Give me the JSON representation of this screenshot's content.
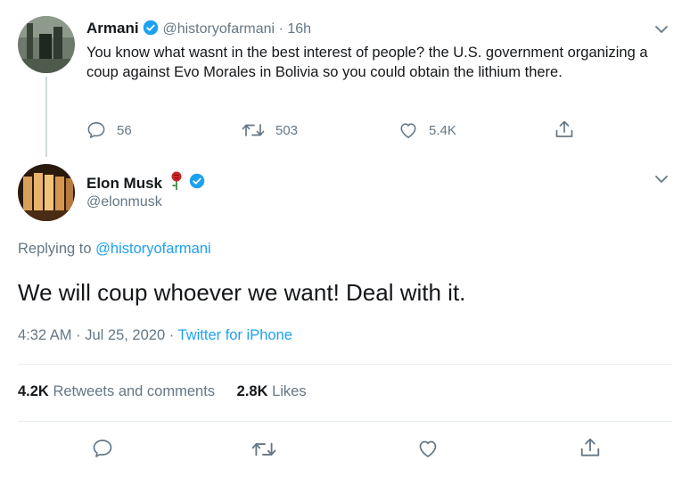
{
  "parent_tweet": {
    "author_name": "Armani",
    "handle": "@historyofarmani",
    "separator": "·",
    "time": "16h",
    "text": "You know what wasnt in the best interest of people? the U.S. government organizing a coup against Evo Morales in Bolivia so you could obtain the lithium there.",
    "replies": "56",
    "retweets": "503",
    "likes": "5.4K"
  },
  "main_tweet": {
    "author_name": "Elon Musk",
    "handle": "@elonmusk",
    "replying_prefix": "Replying to",
    "replying_to": "@historyofarmani",
    "text": "We will coup whoever we want! Deal with it.",
    "time": "4:32 AM",
    "dot1": "·",
    "date": "Jul 25, 2020",
    "dot2": "·",
    "source": "Twitter for iPhone",
    "retweet_count": "4.2K",
    "retweet_label": "Retweets and comments",
    "like_count": "2.8K",
    "like_label": "Likes"
  },
  "icons": {
    "verified": "verified-badge-icon",
    "chevron": "chevron-down-icon",
    "reply": "reply-icon",
    "retweet": "retweet-icon",
    "like": "heart-icon",
    "share": "share-icon",
    "rose": "rose-emoji-icon"
  },
  "colors": {
    "link": "#1da1f2",
    "muted": "#657786",
    "text": "#14171a",
    "divider": "#e6ecf0"
  }
}
